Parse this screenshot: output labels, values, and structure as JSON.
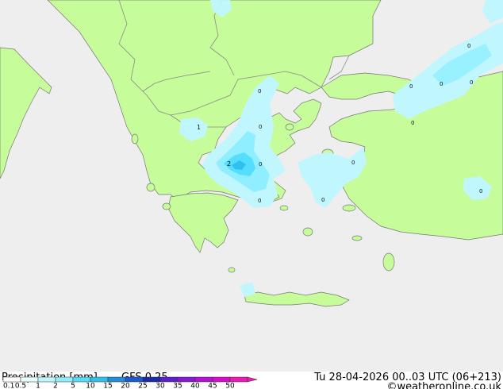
{
  "title": "Precipitation [mm]",
  "model": "GFS 0.25",
  "valid_time": "Tu 28-04-2026 00..03 UTC (06+213)",
  "credit": "©weatheronline.co.uk",
  "legend": {
    "ticks": [
      "0.1",
      "0.5",
      "1",
      "2",
      "5",
      "10",
      "15",
      "20",
      "25",
      "30",
      "35",
      "40",
      "45",
      "50"
    ],
    "colors": [
      "#ffffff",
      "#e6ffff",
      "#c0f7ff",
      "#8feeff",
      "#55ddff",
      "#2ec1f0",
      "#1e8ee0",
      "#1a5ad2",
      "#1b2aa8",
      "#5a1fcf",
      "#8a16d8",
      "#b70ed8",
      "#d80ad0",
      "#ee18b8"
    ]
  },
  "colors": {
    "sea": "#eeeeee",
    "land": "#c6fc9a",
    "border": "#8a8a8a",
    "coast": "#777777"
  },
  "point_labels": [
    "1",
    "2",
    "0",
    "0",
    "0",
    "0",
    "0",
    "0",
    "0",
    "0",
    "0",
    "0",
    "0",
    "0"
  ]
}
